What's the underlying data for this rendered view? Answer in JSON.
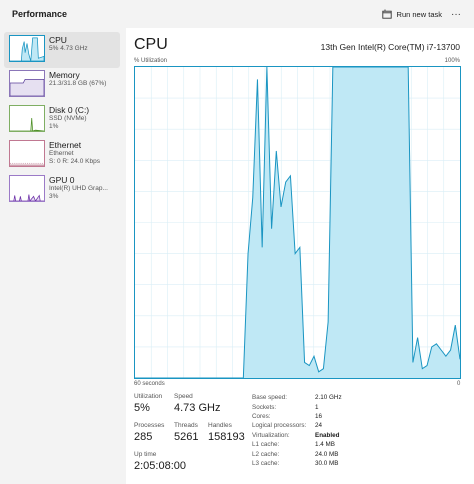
{
  "header": {
    "title": "Performance",
    "run_task_label": "Run new task",
    "more_label": "···"
  },
  "sidebar": {
    "items": [
      {
        "name": "CPU",
        "sub1": "5% 4.73 GHz",
        "sub2": "",
        "color": "#1a95c2"
      },
      {
        "name": "Memory",
        "sub1": "21.3/31.8 GB (67%)",
        "sub2": "",
        "color": "#5b3f9a"
      },
      {
        "name": "Disk 0 (C:)",
        "sub1": "SSD (NVMe)",
        "sub2": "1%",
        "color": "#4e8f27"
      },
      {
        "name": "Ethernet",
        "sub1": "Ethernet",
        "sub2": "S: 0 R: 24.0 Kbps",
        "color": "#a0405f"
      },
      {
        "name": "GPU 0",
        "sub1": "Intel(R) UHD Grap...",
        "sub2": "3%",
        "color": "#6d31a8"
      }
    ]
  },
  "main": {
    "title": "CPU",
    "model": "13th Gen Intel(R) Core(TM) i7-13700",
    "y_axis_label": "% Utilization",
    "y_max_label": "100%",
    "x_left_label": "60 seconds",
    "x_right_label": "0",
    "accent": "#1a95c2",
    "fill": "#bfe8f5"
  },
  "chart_data": {
    "type": "area",
    "x_range": [
      60,
      0
    ],
    "ylim": [
      0,
      100
    ],
    "grid": true,
    "values": [
      0,
      0,
      0,
      0,
      0,
      0,
      0,
      0,
      0,
      0,
      0,
      0,
      0,
      0,
      0,
      0,
      0,
      0,
      0,
      0,
      0,
      0,
      0,
      0,
      40,
      58,
      96,
      42,
      100,
      48,
      73,
      55,
      63,
      65,
      40,
      42,
      5,
      4,
      7,
      2,
      3,
      18,
      100,
      100,
      100,
      100,
      100,
      100,
      100,
      100,
      100,
      100,
      100,
      100,
      100,
      100,
      100,
      100,
      100,
      5,
      13,
      3,
      4,
      10,
      11,
      9,
      7,
      9,
      17,
      6
    ]
  },
  "stats": {
    "utilization": {
      "label": "Utilization",
      "value": "5%"
    },
    "speed": {
      "label": "Speed",
      "value": "4.73 GHz"
    },
    "processes": {
      "label": "Processes",
      "value": "285"
    },
    "threads": {
      "label": "Threads",
      "value": "5261"
    },
    "handles": {
      "label": "Handles",
      "value": "158193"
    },
    "uptime": {
      "label": "Up time",
      "value": "2:05:08:00"
    }
  },
  "specs": [
    {
      "k": "Base speed:",
      "v": "2.10 GHz",
      "bold": false
    },
    {
      "k": "Sockets:",
      "v": "1",
      "bold": false
    },
    {
      "k": "Cores:",
      "v": "16",
      "bold": false
    },
    {
      "k": "Logical processors:",
      "v": "24",
      "bold": false
    },
    {
      "k": "Virtualization:",
      "v": "Enabled",
      "bold": true
    },
    {
      "k": "L1 cache:",
      "v": "1.4 MB",
      "bold": false
    },
    {
      "k": "L2 cache:",
      "v": "24.0 MB",
      "bold": false
    },
    {
      "k": "L3 cache:",
      "v": "30.0 MB",
      "bold": false
    }
  ]
}
